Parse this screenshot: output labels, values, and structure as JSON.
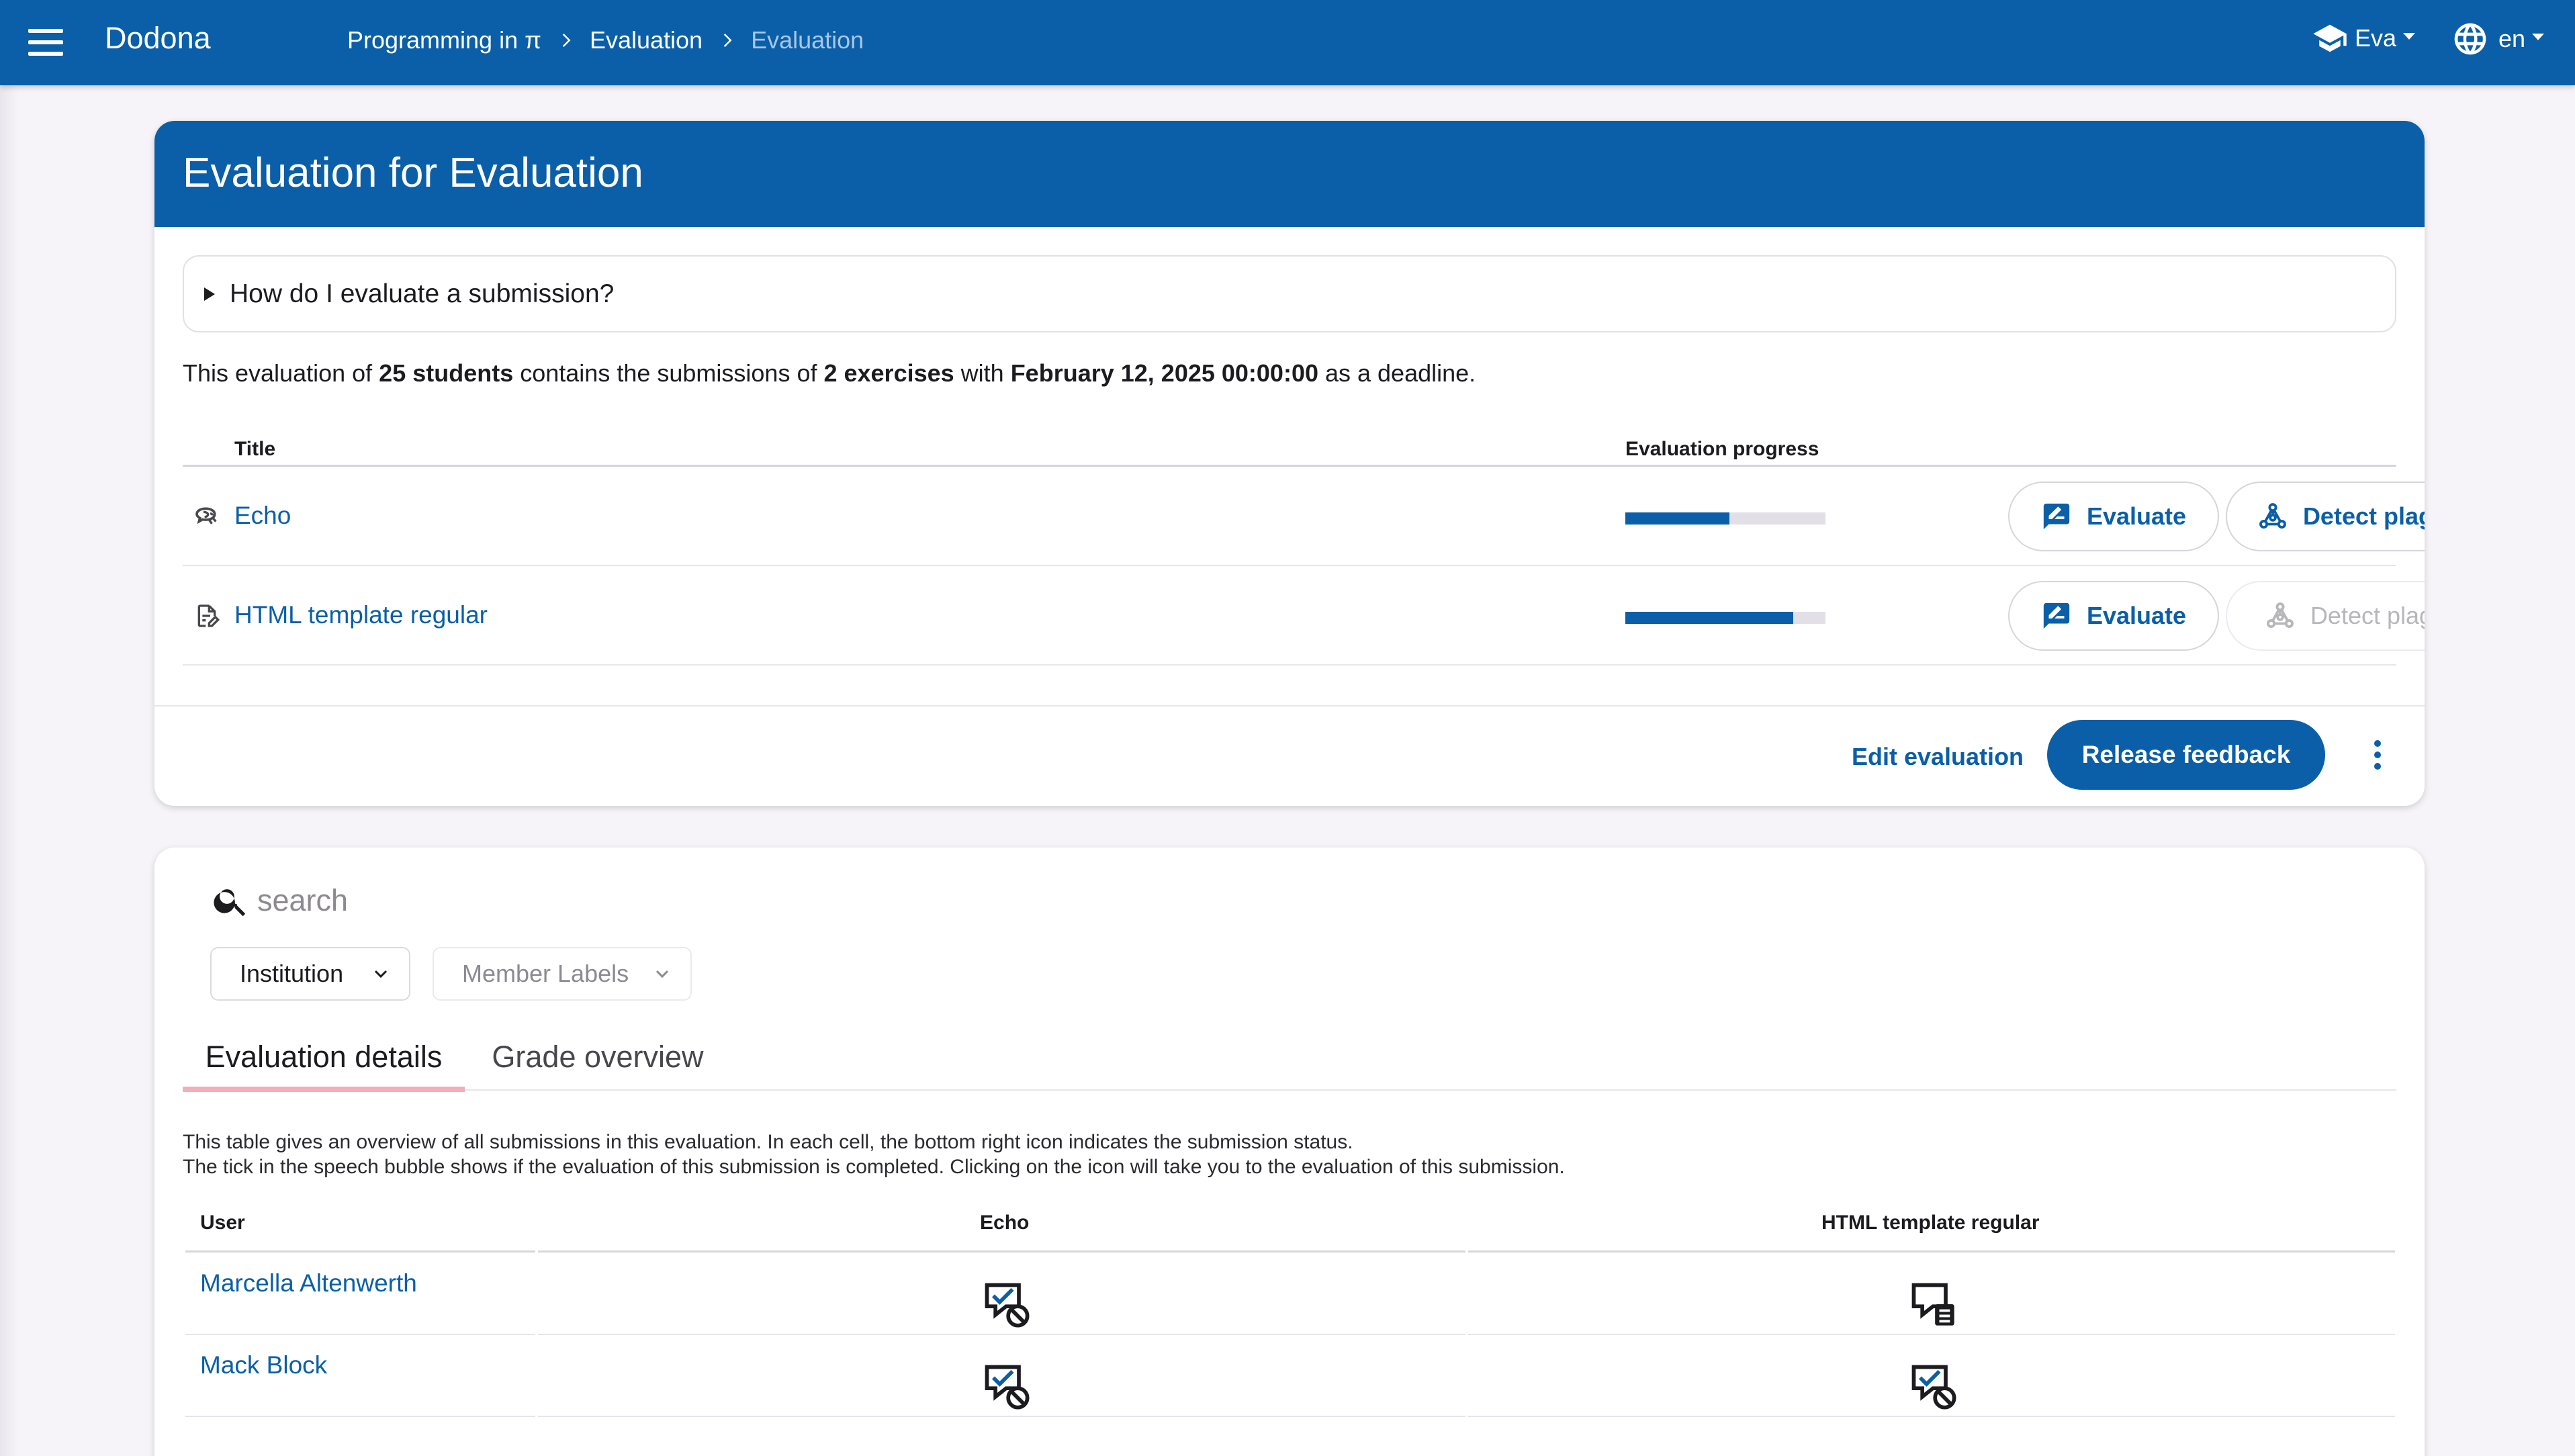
{
  "topbar": {
    "brand": "Dodona",
    "breadcrumbs": [
      "Programming in π",
      "Evaluation",
      "Evaluation"
    ],
    "user": "Eva",
    "language": "en"
  },
  "evaluation": {
    "title": "Evaluation for Evaluation",
    "details_summary": "How do I evaluate a submission?",
    "summary": {
      "prefix": "This evaluation of ",
      "students": "25 students",
      "mid": " contains the submissions of ",
      "exercises": "2 exercises",
      "with": " with ",
      "deadline": "February 12, 2025 00:00:00",
      "suffix": " as a deadline."
    },
    "table_headers": {
      "title": "Title",
      "progress": "Evaluation progress"
    },
    "exercises": [
      {
        "name": "Echo",
        "icon": "exercise-echo-icon",
        "progress": 0.52,
        "evaluate": "Evaluate",
        "plagiarism": "Detect plagiarism",
        "plagiarism_enabled": true
      },
      {
        "name": "HTML template regular",
        "icon": "exercise-content-icon",
        "progress": 0.84,
        "evaluate": "Evaluate",
        "plagiarism": "Detect plagiarism",
        "plagiarism_enabled": false
      }
    ],
    "edit_label": "Edit evaluation",
    "release_label": "Release feedback"
  },
  "submissions": {
    "search_placeholder": "search",
    "filters": [
      "Institution",
      "Member Labels"
    ],
    "tabs": [
      "Evaluation details",
      "Grade overview"
    ],
    "active_tab": "Evaluation details",
    "explanation": [
      "This table gives an overview of all submissions in this evaluation. In each cell, the bottom right icon indicates the submission status.",
      "The tick in the speech bubble shows if the evaluation of this submission is completed. Clicking on the icon will take you to the evaluation of this submission."
    ],
    "headers": {
      "user": "User",
      "col1": "Echo",
      "col2": "HTML template regular"
    },
    "rows": [
      {
        "user": "Marcella Altenwerth",
        "echo": "evaluated-no-submission-icon",
        "html": "not-evaluated-wrong-icon"
      },
      {
        "user": "Mack Block",
        "echo": "evaluated-no-submission-icon",
        "html": "evaluated-no-submission-icon"
      }
    ]
  },
  "colors": {
    "primary": "#0a5fa8",
    "tab_indicator": "#f3aebb",
    "background": "#f6f4f8"
  }
}
